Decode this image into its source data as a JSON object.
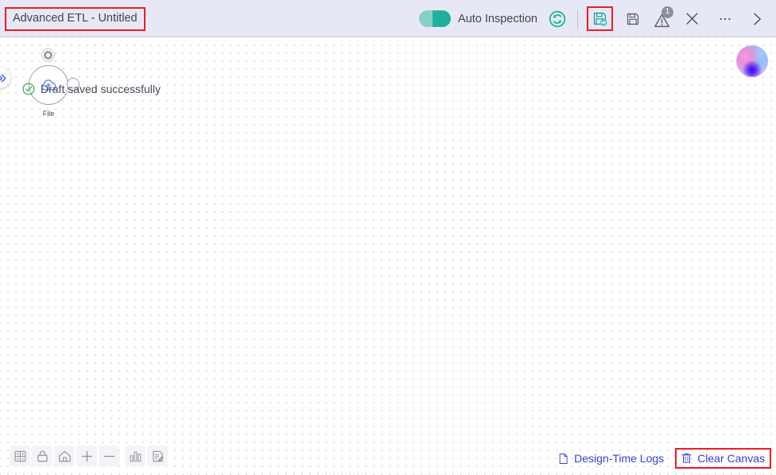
{
  "header": {
    "title": "Advanced ETL - Untitled",
    "auto_inspection_label": "Auto Inspection",
    "auto_inspection_on": true,
    "refresh_icon": "refresh-icon",
    "save_draft_icon": "save-draft-icon",
    "save_icon": "save-icon",
    "warning_icon": "warning-triangle-icon",
    "warning_count": "1",
    "close_icon": "close-icon",
    "more_icon": "more-ellipsis-icon",
    "expand_icon": "chevron-right-icon",
    "accent_highlight": "#ee1c25",
    "toggle_color": "#20b2a0",
    "background": "#e6e9f5"
  },
  "canvas": {
    "collapse_handle_icon": "double-chevron-right-icon",
    "toast": {
      "icon": "check-circle-icon",
      "text": "Draft saved successfully",
      "icon_color": "#2aa84a"
    },
    "node": {
      "label": "File",
      "icon": "cloud-upload-icon",
      "icon_color": "#6a7fe8",
      "badge_icon": "status-dot-icon",
      "port_icon": "output-port-icon"
    },
    "avatar": "user-avatar-orb"
  },
  "bottom_toolbar": {
    "items": [
      {
        "name": "fit-grid-button",
        "icon": "grid-layout-icon"
      },
      {
        "name": "lock-button",
        "icon": "lock-icon"
      },
      {
        "name": "home-button",
        "icon": "home-icon"
      },
      {
        "name": "zoom-in-button",
        "icon": "plus-icon"
      },
      {
        "name": "zoom-out-button",
        "icon": "minus-icon"
      },
      {
        "name": "statistics-button",
        "icon": "bar-chart-icon"
      },
      {
        "name": "notes-button",
        "icon": "edit-document-icon"
      }
    ]
  },
  "bottom_right": {
    "design_time_logs": {
      "label": "Design-Time Logs",
      "icon": "file-document-icon"
    },
    "clear_canvas": {
      "label": "Clear Canvas",
      "icon": "trash-icon"
    },
    "link_color": "#3a3fd4"
  }
}
